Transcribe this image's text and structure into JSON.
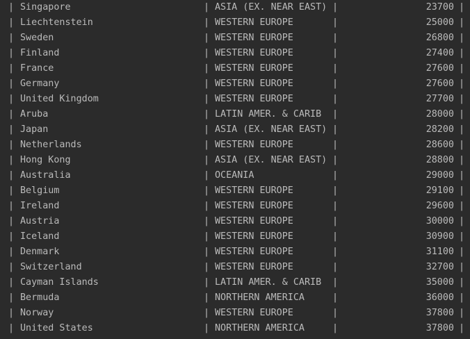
{
  "console": {
    "separator": "|",
    "rows": [
      {
        "country": "Singapore",
        "region": "ASIA (EX. NEAR EAST)",
        "value": "23700"
      },
      {
        "country": "Liechtenstein",
        "region": "WESTERN EUROPE",
        "value": "25000"
      },
      {
        "country": "Sweden",
        "region": "WESTERN EUROPE",
        "value": "26800"
      },
      {
        "country": "Finland",
        "region": "WESTERN EUROPE",
        "value": "27400"
      },
      {
        "country": "France",
        "region": "WESTERN EUROPE",
        "value": "27600"
      },
      {
        "country": "Germany",
        "region": "WESTERN EUROPE",
        "value": "27600"
      },
      {
        "country": "United Kingdom",
        "region": "WESTERN EUROPE",
        "value": "27700"
      },
      {
        "country": "Aruba",
        "region": "LATIN AMER. & CARIB",
        "value": "28000"
      },
      {
        "country": "Japan",
        "region": "ASIA (EX. NEAR EAST)",
        "value": "28200"
      },
      {
        "country": "Netherlands",
        "region": "WESTERN EUROPE",
        "value": "28600"
      },
      {
        "country": "Hong Kong",
        "region": "ASIA (EX. NEAR EAST)",
        "value": "28800"
      },
      {
        "country": "Australia",
        "region": "OCEANIA",
        "value": "29000"
      },
      {
        "country": "Belgium",
        "region": "WESTERN EUROPE",
        "value": "29100"
      },
      {
        "country": "Ireland",
        "region": "WESTERN EUROPE",
        "value": "29600"
      },
      {
        "country": "Austria",
        "region": "WESTERN EUROPE",
        "value": "30000"
      },
      {
        "country": "Iceland",
        "region": "WESTERN EUROPE",
        "value": "30900"
      },
      {
        "country": "Denmark",
        "region": "WESTERN EUROPE",
        "value": "31100"
      },
      {
        "country": "Switzerland",
        "region": "WESTERN EUROPE",
        "value": "32700"
      },
      {
        "country": "Cayman Islands",
        "region": "LATIN AMER. & CARIB",
        "value": "35000"
      },
      {
        "country": "Bermuda",
        "region": "NORTHERN AMERICA",
        "value": "36000"
      },
      {
        "country": "Norway",
        "region": "WESTERN EUROPE",
        "value": "37800"
      },
      {
        "country": "United States",
        "region": "NORTHERN AMERICA",
        "value": "37800"
      }
    ]
  }
}
